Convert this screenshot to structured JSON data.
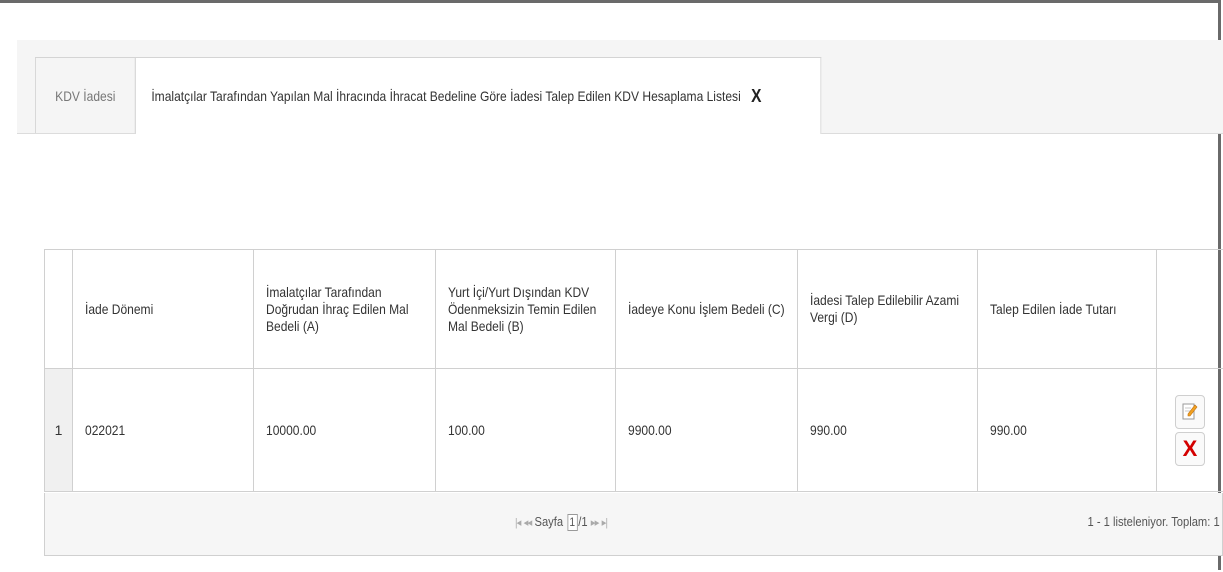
{
  "tabs": [
    {
      "label": "KDV İadesi"
    },
    {
      "label": "İmalatçılar Tarafından Yapılan Mal İhracında İhracat Bedeline Göre İadesi Talep Edilen KDV Hesaplama Listesi",
      "close": "X"
    }
  ],
  "table": {
    "columns": [
      "İade Dönemi",
      "İmalatçılar Tarafından Doğrudan İhraç Edilen Mal Bedeli (A)",
      "Yurt İçi/Yurt Dışından KDV Ödenmeksizin Temin Edilen Mal Bedeli (B)",
      "İadeye Konu İşlem Bedeli (C)",
      "İadesi Talep Edilebilir Azami Vergi (D)",
      "Talep Edilen İade Tutarı"
    ],
    "rows": [
      {
        "num": "1",
        "cells": [
          "022021",
          "10000.00",
          "100.00",
          "9900.00",
          "990.00",
          "990.00"
        ]
      }
    ]
  },
  "icons": {
    "edit": "edit-pencil-icon",
    "delete": "delete-x-icon",
    "delete_glyph": "X"
  },
  "pager": {
    "first": "|◂",
    "prev": "◂◂",
    "label": "Sayfa",
    "page": "1",
    "total": "/1",
    "next": "▸▸",
    "last": "▸|",
    "info": "1 - 1 listeleniyor. Toplam: 1"
  },
  "colors": {
    "delete": "#d40000",
    "border": "#d0d0d0"
  }
}
